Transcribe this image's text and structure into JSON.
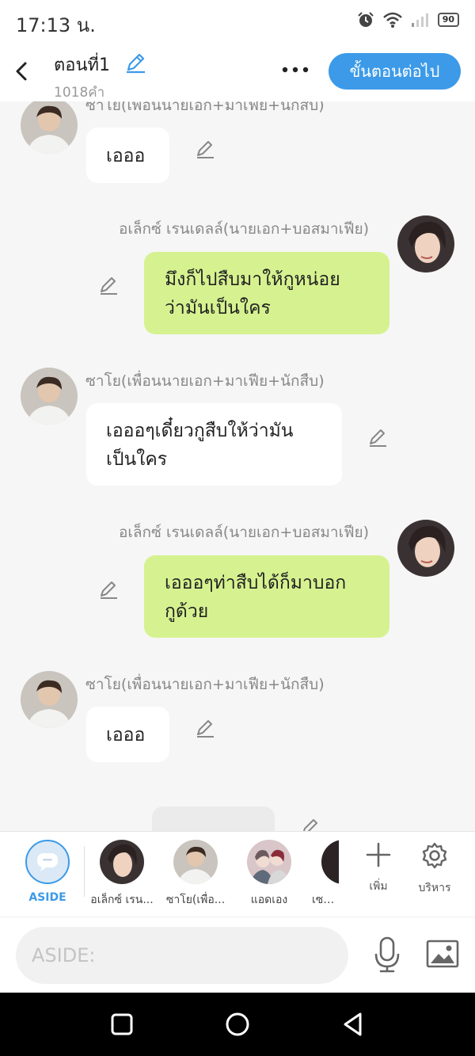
{
  "status_bar": {
    "time": "17:13 น.",
    "battery": "90"
  },
  "header": {
    "title": "ตอนที่1",
    "word_count": "1018คำ",
    "next_label": "ขั้นตอนต่อไป"
  },
  "messages": [
    {
      "side": "left",
      "speaker": "ซาโย(เพื่อนนายเอก+มาเฟีย+นักสืบ)",
      "text": "เอออ"
    },
    {
      "side": "right",
      "speaker": "อเล็กซ์ เรนเดลล์(นายเอก+บอสมาเฟีย)",
      "line1": "มึงก็ไปสืบมาให้กูหน่อย",
      "line2": "ว่ามันเป็นใคร"
    },
    {
      "side": "left",
      "speaker": "ซาโย(เพื่อนนายเอก+มาเฟีย+นักสืบ)",
      "line1": "เอออๆเดี๋ยวกูสืบให้ว่ามัน",
      "line2": "เป็นใคร"
    },
    {
      "side": "right",
      "speaker": "อเล็กซ์ เรนเดลล์(นายเอก+บอสมาเฟีย)",
      "line1": "เอออๆท่าสืบได้ก็มาบอก",
      "line2": "กูด้วย"
    },
    {
      "side": "left",
      "speaker": "ซาโย(เพื่อนนายเอก+มาเฟีย+นักสืบ)",
      "text": "เอออ"
    }
  ],
  "characters": [
    {
      "name": "ASIDE",
      "selected": true,
      "icon": "chat-bubble-icon"
    },
    {
      "name": "อเล็กซ์ เรน..."
    },
    {
      "name": "ซาโย(เพื่อ..."
    },
    {
      "name": "แอดเอง"
    },
    {
      "name": "เซย่าเ"
    }
  ],
  "tools": {
    "add_label": "เพิ่ม",
    "manage_label": "บริหาร"
  },
  "input": {
    "placeholder": "ASIDE:"
  },
  "colors": {
    "accent": "#3c9ae8",
    "right_bubble": "#d6f290",
    "left_bubble": "#ffffff"
  }
}
